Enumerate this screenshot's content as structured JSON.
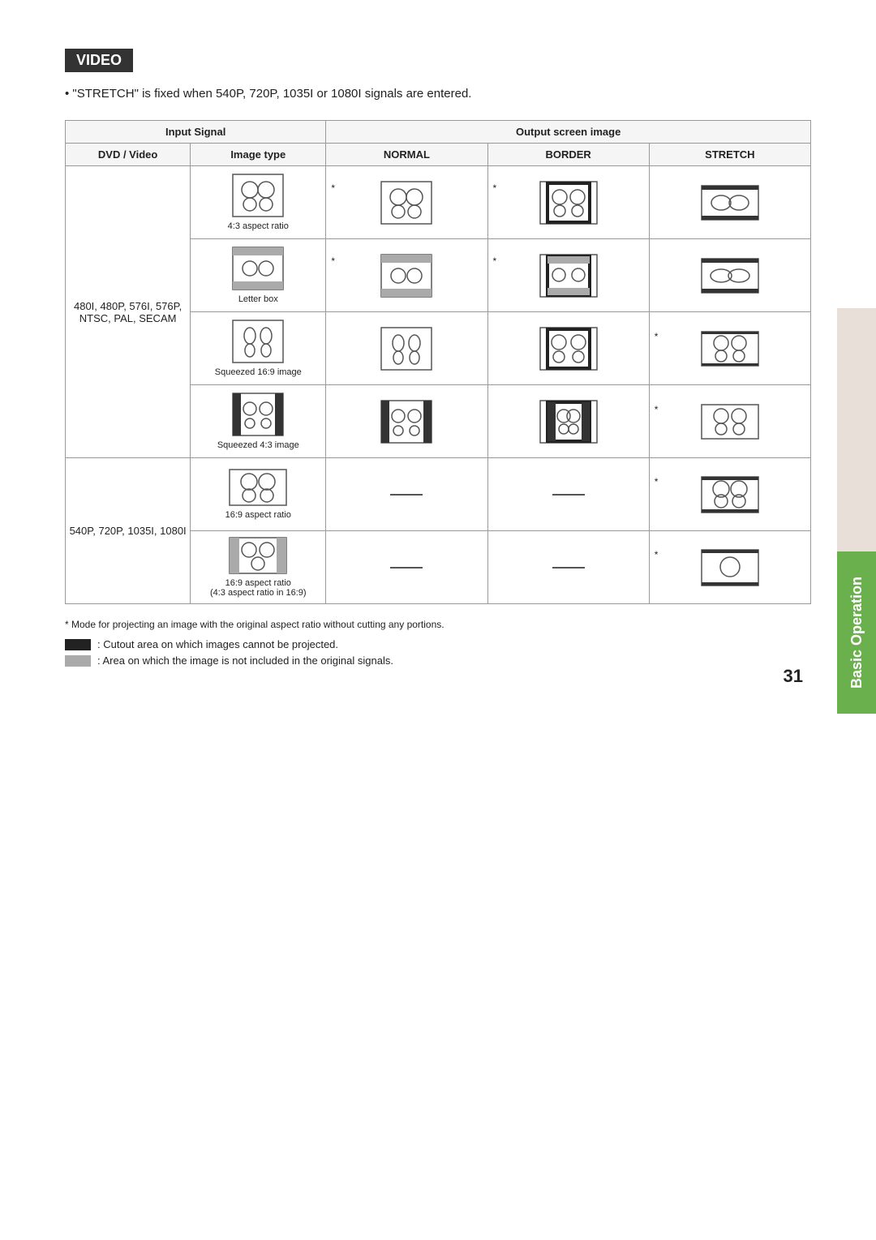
{
  "page": {
    "number": "31",
    "title": "VIDEO"
  },
  "intro": {
    "text": "• \"STRETCH\" is fixed when 540P, 720P, 1035I or 1080I signals are entered."
  },
  "table": {
    "input_signal_header": "Input Signal",
    "output_screen_header": "Output screen image",
    "col_dvd": "DVD / Video",
    "col_imgtype": "Image type",
    "col_normal": "NORMAL",
    "col_border": "BORDER",
    "col_stretch": "STRETCH",
    "row1_dvd": "480I, 480P, 576I, 576P, NTSC, PAL, SECAM",
    "row1_img1_label": "4:3 aspect ratio",
    "row1_img2_label": "Letter box",
    "row1_img3_label": "Squeezed 16:9 image",
    "row1_img4_label": "Squeezed 4:3 image",
    "row2_dvd": "540P, 720P, 1035I, 1080I",
    "row2_img1_label": "16:9 aspect ratio",
    "row2_img2_label": "16:9 aspect ratio\n(4:3 aspect ratio in 16:9)"
  },
  "legend": {
    "note": "* Mode for projecting an image with the original aspect ratio without cutting any portions.",
    "black_label": ": Cutout area on which images cannot be projected.",
    "gray_label": ": Area on which the image is not included in the original signals."
  },
  "sidebar": {
    "tab_label": "Basic Operation"
  }
}
